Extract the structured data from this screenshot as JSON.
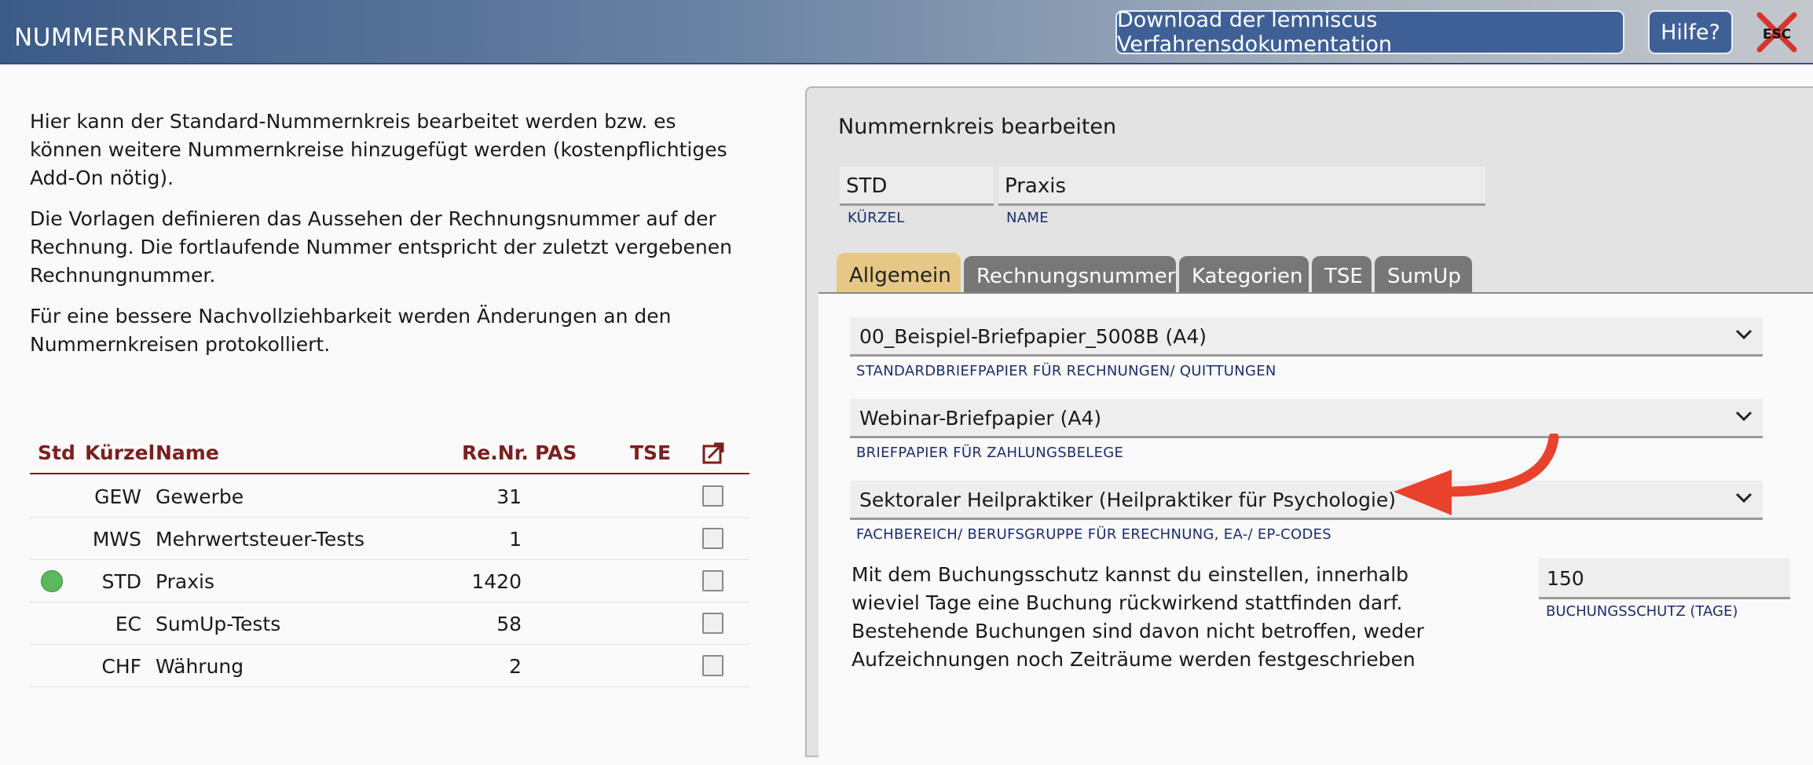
{
  "header": {
    "title": "NUMMERNKREISE",
    "download_label": "Download der lemniscus Verfahrensdokumentation",
    "help_label": "Hilfe?",
    "esc_label": "ESC"
  },
  "intro": {
    "p1": "Hier kann der Standard-Nummernkreis bearbeitet werden bzw. es können weitere Nummernkreise hinzugefügt werden (kostenpflichtiges Add-On nötig).",
    "p2": "Die Vorlagen definieren das Aussehen der Rechnungsnummer auf der Rechnung. Die fortlaufende Nummer entspricht der zuletzt vergebenen Rechnungnummer.",
    "p3": "Für eine bessere Nachvollziehbarkeit werden Änderungen an den Nummernkreisen protokolliert."
  },
  "table": {
    "headers": {
      "std": "Std",
      "kuerzel": "Kürzel",
      "name": "Name",
      "renr": "Re.Nr.",
      "pas": "PAS",
      "tse": "TSE"
    },
    "rows": [
      {
        "kuerzel": "GEW",
        "name": "Gewerbe",
        "renr": "31",
        "std": false
      },
      {
        "kuerzel": "MWS",
        "name": "Mehrwertsteuer-Tests",
        "renr": "1",
        "std": false
      },
      {
        "kuerzel": "STD",
        "name": "Praxis",
        "renr": "1420",
        "std": true
      },
      {
        "kuerzel": "EC",
        "name": "SumUp-Tests",
        "renr": "58",
        "std": false
      },
      {
        "kuerzel": "CHF",
        "name": "Währung",
        "renr": "2",
        "std": false
      }
    ]
  },
  "panel": {
    "title": "Nummernkreis bearbeiten",
    "kuerzel_value": "STD",
    "kuerzel_label": "KÜRZEL",
    "name_value": "Praxis",
    "name_label": "NAME",
    "tabs": [
      {
        "label": "Allgemein",
        "active": true
      },
      {
        "label": "Rechnungsnummer",
        "active": false
      },
      {
        "label": "Kategorien",
        "active": false
      },
      {
        "label": "TSE",
        "active": false
      },
      {
        "label": "SumUp",
        "active": false
      }
    ],
    "selects": [
      {
        "value": "00_Beispiel-Briefpapier_5008B (A4)",
        "label": "STANDARDBRIEFPAPIER FÜR RECHNUNGEN/ QUITTUNGEN"
      },
      {
        "value": "Webinar-Briefpapier (A4)",
        "label": "BRIEFPAPIER FÜR ZAHLUNGSBELEGE"
      },
      {
        "value": "Sektoraler Heilpraktiker (Heilpraktiker für Psychologie)",
        "label": "FACHBEREICH/ BERUFSGRUPPE FÜR ERECHNUNG, EA-/ EP-CODES"
      }
    ],
    "description": "Mit dem Buchungsschutz kannst du einstellen, innerhalb wieviel Tage eine Buchung rückwirkend stattfinden darf. Bestehende Buchungen sind davon nicht betroffen, weder Aufzeichnungen noch Zeiträume werden festgeschrieben",
    "schutz_value": "150",
    "schutz_label": "BUCHUNGSSCHUTZ (TAGE)"
  },
  "colors": {
    "header_blue": "#3b5a86",
    "accent_red": "#7b1f1f",
    "active_tab": "#e6c785",
    "arrow": "#e8412c",
    "std_dot": "#5cb85c"
  }
}
